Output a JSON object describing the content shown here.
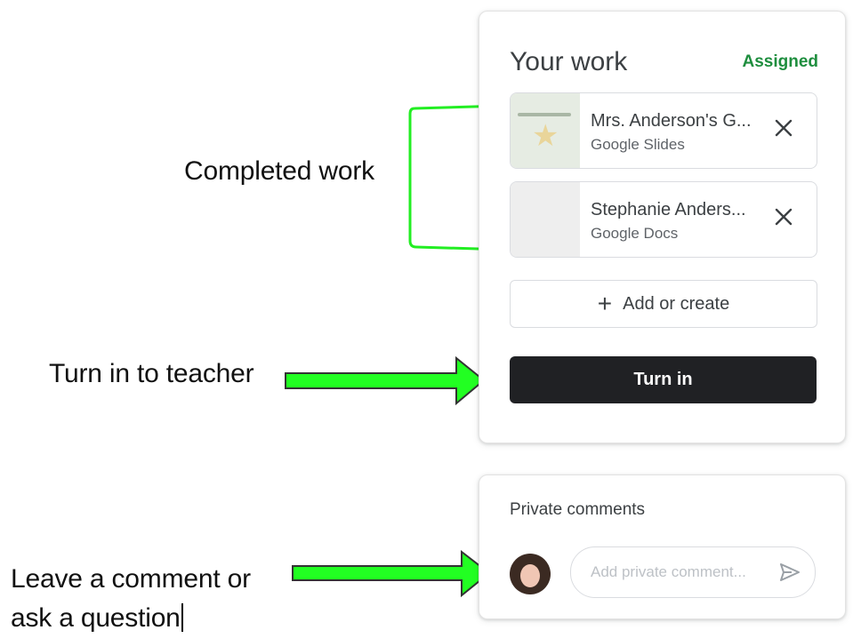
{
  "annotations": {
    "completed_work": "Completed work",
    "turn_in_to_teacher": "Turn in to teacher",
    "leave_comment_line1": "Leave a comment or",
    "leave_comment_line2": "ask a question"
  },
  "your_work": {
    "title": "Your work",
    "status": "Assigned",
    "attachments": [
      {
        "name": "Mrs. Anderson's G...",
        "type": "Google Slides",
        "icon": "close-icon"
      },
      {
        "name": "Stephanie Anders...",
        "type": "Google Docs",
        "icon": "close-icon"
      }
    ],
    "add_label": "Add or create",
    "turn_in_label": "Turn in"
  },
  "private_comments": {
    "title": "Private comments",
    "placeholder": "Add private comment...",
    "send_icon": "send-icon"
  },
  "colors": {
    "status_green": "#1e8e3e",
    "arrow_green": "#22ff22",
    "button_dark": "#202124"
  }
}
